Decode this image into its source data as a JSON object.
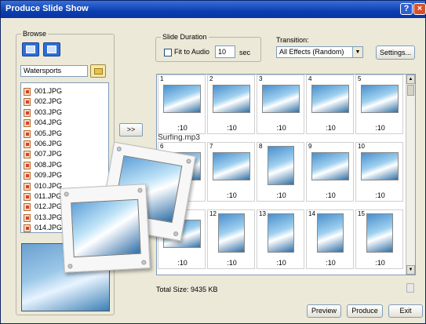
{
  "window": {
    "title": "Produce Slide Show",
    "help_glyph": "?",
    "close_glyph": "×"
  },
  "browse": {
    "label": "Browse",
    "folder": "Watersports",
    "add_button": ">>",
    "files": [
      "001.JPG",
      "002.JPG",
      "003.JPG",
      "004.JPG",
      "005.JPG",
      "006.JPG",
      "007.JPG",
      "008.JPG",
      "009.JPG",
      "010.JPG",
      "011.JPG",
      "012.JPG",
      "013.JPG",
      "014.JPG"
    ]
  },
  "duration": {
    "label": "Slide Duration",
    "fit_label": "Fit to Audio",
    "fit_checked": false,
    "value": "10",
    "unit": "sec"
  },
  "transition": {
    "label": "Transition:",
    "selected": "All Effects (Random)"
  },
  "settings_label": "Settings...",
  "storyboard": {
    "music": "Surfing.mp3",
    "slides": [
      {
        "num": "1",
        "dur": ":10"
      },
      {
        "num": "2",
        "dur": ":10"
      },
      {
        "num": "3",
        "dur": ":10"
      },
      {
        "num": "4",
        "dur": ":10"
      },
      {
        "num": "5",
        "dur": ":10"
      },
      {
        "num": "6",
        "dur": ":10"
      },
      {
        "num": "7",
        "dur": ":10"
      },
      {
        "num": "8",
        "dur": ":10"
      },
      {
        "num": "9",
        "dur": ":10"
      },
      {
        "num": "10",
        "dur": ":10"
      },
      {
        "num": "",
        "dur": ":10"
      },
      {
        "num": "12",
        "dur": ":10"
      },
      {
        "num": "13",
        "dur": ":10"
      },
      {
        "num": "14",
        "dur": ":10"
      },
      {
        "num": "15",
        "dur": ":10"
      }
    ]
  },
  "total_size": "Total Size: 9435 KB",
  "buttons": {
    "preview": "Preview",
    "produce": "Produce",
    "exit": "Exit"
  }
}
